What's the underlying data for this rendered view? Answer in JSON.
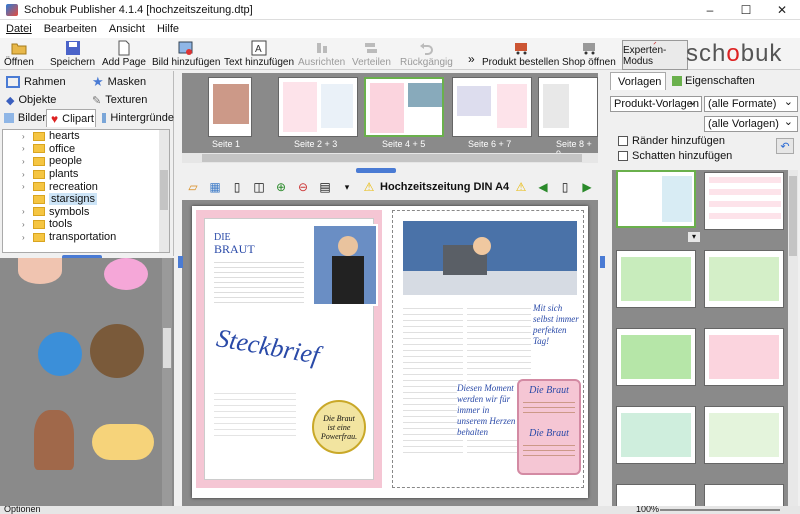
{
  "window": {
    "title": "Schobuk Publisher 4.1.4 [hochzeitszeitung.dtp]"
  },
  "menu": [
    "Datei",
    "Bearbeiten",
    "Ansicht",
    "Hilfe"
  ],
  "toolbar": {
    "items": [
      {
        "label": "Öffnen",
        "enabled": true
      },
      {
        "label": "Speichern",
        "enabled": true
      },
      {
        "label": "Add Page",
        "enabled": true
      },
      {
        "label": "Bild hinzufügen",
        "enabled": true
      },
      {
        "label": "Text hinzufügen",
        "enabled": true
      },
      {
        "label": "Ausrichten",
        "enabled": false
      },
      {
        "label": "Verteilen",
        "enabled": false
      },
      {
        "label": "Rückgängig",
        "enabled": false
      },
      {
        "label": "Produkt bestellen",
        "enabled": true
      },
      {
        "label": "Shop öffnen",
        "enabled": true
      },
      {
        "label": "Experten-Modus",
        "enabled": true
      }
    ],
    "more": "»"
  },
  "logo": {
    "pre": "sch",
    "mid": "o",
    "post": "buk"
  },
  "left_tabs": {
    "rahmen": "Rahmen",
    "masken": "Masken",
    "objekte": "Objekte",
    "texturen": "Texturen",
    "bilder": "Bilder",
    "clipart": "Clipart",
    "hintergruende": "Hintergründe"
  },
  "tree": [
    "hearts",
    "office",
    "people",
    "plants",
    "recreation",
    "starsigns",
    "symbols",
    "tools",
    "transportation"
  ],
  "tree_selected": "starsigns",
  "pages": [
    "Seite 1",
    "Seite 2 + 3",
    "Seite 4 + 5",
    "Seite 6 + 7",
    "Seite 8 + 9"
  ],
  "doc_toolbar": {
    "product": "Hochzeitszeitung DIN A4"
  },
  "document": {
    "heading_small": "DIE",
    "heading_big": "BRAUT",
    "script_title": "Steckbrief",
    "badge": "Die Braut ist eine Powerfrau.",
    "box_title1": "Die Braut",
    "box_title2": "Die Braut",
    "side_text1": "Mit sich selbst immer perfekten Tag!",
    "side_text2": "Diesen Moment werden wir für immer in unserem Herzen behalten"
  },
  "right_tabs": {
    "vorlagen": "Vorlagen",
    "eigenschaften": "Eigenschaften"
  },
  "right": {
    "select1": "Produkt-Vorlagen",
    "select2": "(alle Formate)",
    "select3": "(alle Vorlagen)",
    "check1": "Ränder hinzufügen",
    "check2": "Schatten hinzufügen"
  },
  "status": {
    "left": "Optionen",
    "zoom": "100%"
  },
  "colors": {
    "accent": "#6ab04c",
    "pink": "#f1c3d2",
    "green": "#b6e6a8"
  }
}
